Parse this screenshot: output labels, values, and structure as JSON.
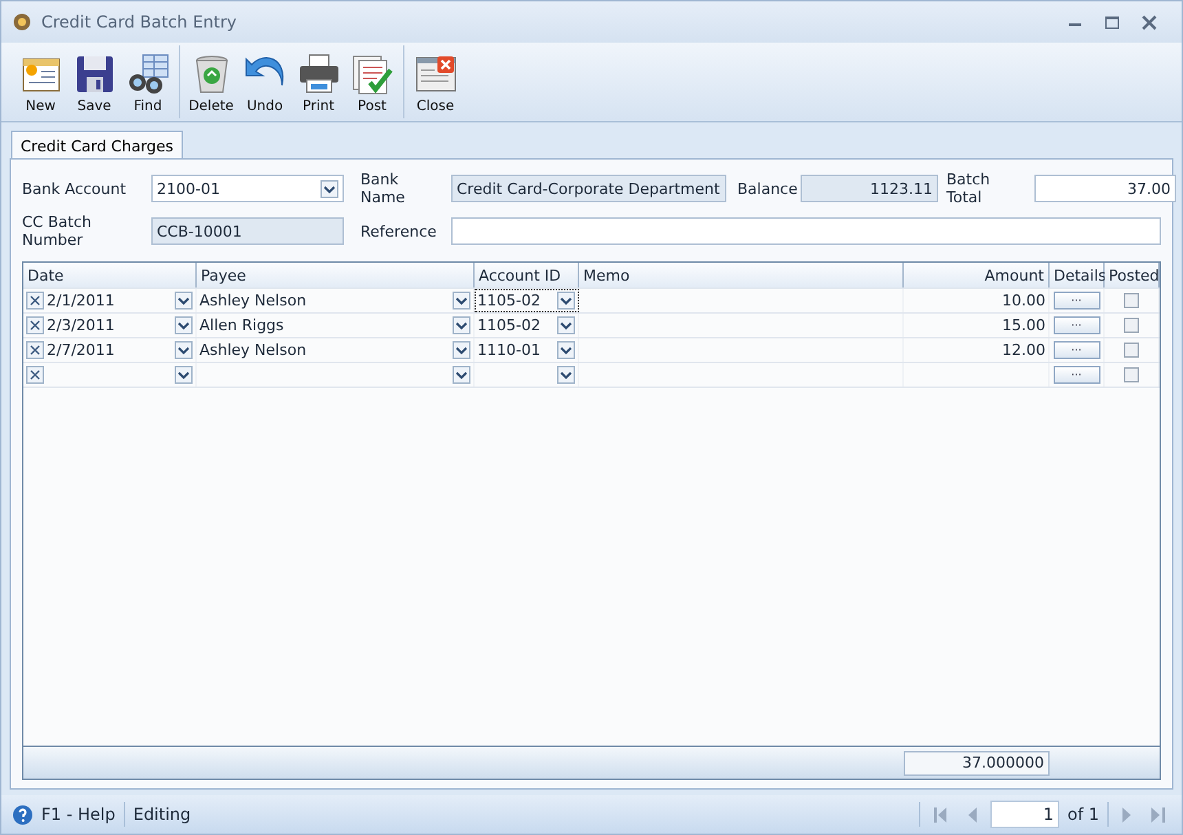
{
  "window": {
    "title": "Credit Card Batch Entry"
  },
  "toolbar": {
    "groups": [
      [
        {
          "label": "New",
          "kind": "new"
        },
        {
          "label": "Save",
          "kind": "save"
        },
        {
          "label": "Find",
          "kind": "find"
        }
      ],
      [
        {
          "label": "Delete",
          "kind": "delete"
        },
        {
          "label": "Undo",
          "kind": "undo"
        },
        {
          "label": "Print",
          "kind": "print"
        },
        {
          "label": "Post",
          "kind": "post"
        }
      ],
      [
        {
          "label": "Close",
          "kind": "close"
        }
      ]
    ]
  },
  "tabs": [
    {
      "label": "Credit Card Charges",
      "selected": true
    }
  ],
  "form": {
    "bank_account": {
      "label": "Bank Account",
      "value": "2100-01"
    },
    "bank_name": {
      "label": "Bank Name",
      "value": "Credit Card-Corporate Department"
    },
    "balance": {
      "label": "Balance",
      "value": "1123.11"
    },
    "batch_total": {
      "label": "Batch Total",
      "value": "37.00"
    },
    "cc_batch_number": {
      "label": "CC Batch Number",
      "value": "CCB-10001"
    },
    "reference": {
      "label": "Reference"
    }
  },
  "grid": {
    "columns": [
      "Date",
      "Payee",
      "Account ID",
      "Memo",
      "Amount",
      "Details",
      "Posted"
    ],
    "rows": [
      {
        "date": "2/1/2011",
        "payee": "Ashley  Nelson",
        "account_id": "1105-02",
        "amount": "10.00",
        "details": "···",
        "posted": false,
        "selected": true
      },
      {
        "date": "2/3/2011",
        "payee": "Allen Riggs",
        "account_id": "1105-02",
        "amount": "15.00",
        "details": "···",
        "posted": false,
        "selected": false
      },
      {
        "date": "2/7/2011",
        "payee": "Ashley  Nelson",
        "account_id": "1110-01",
        "amount": "12.00",
        "details": "···",
        "posted": false,
        "selected": false
      },
      {
        "details": "···",
        "posted": false,
        "selected": false
      }
    ],
    "footer_total": "37.000000"
  },
  "status_bar": {
    "help": "F1 - Help",
    "mode": "Editing",
    "page": "1",
    "page_count": "of 1"
  }
}
